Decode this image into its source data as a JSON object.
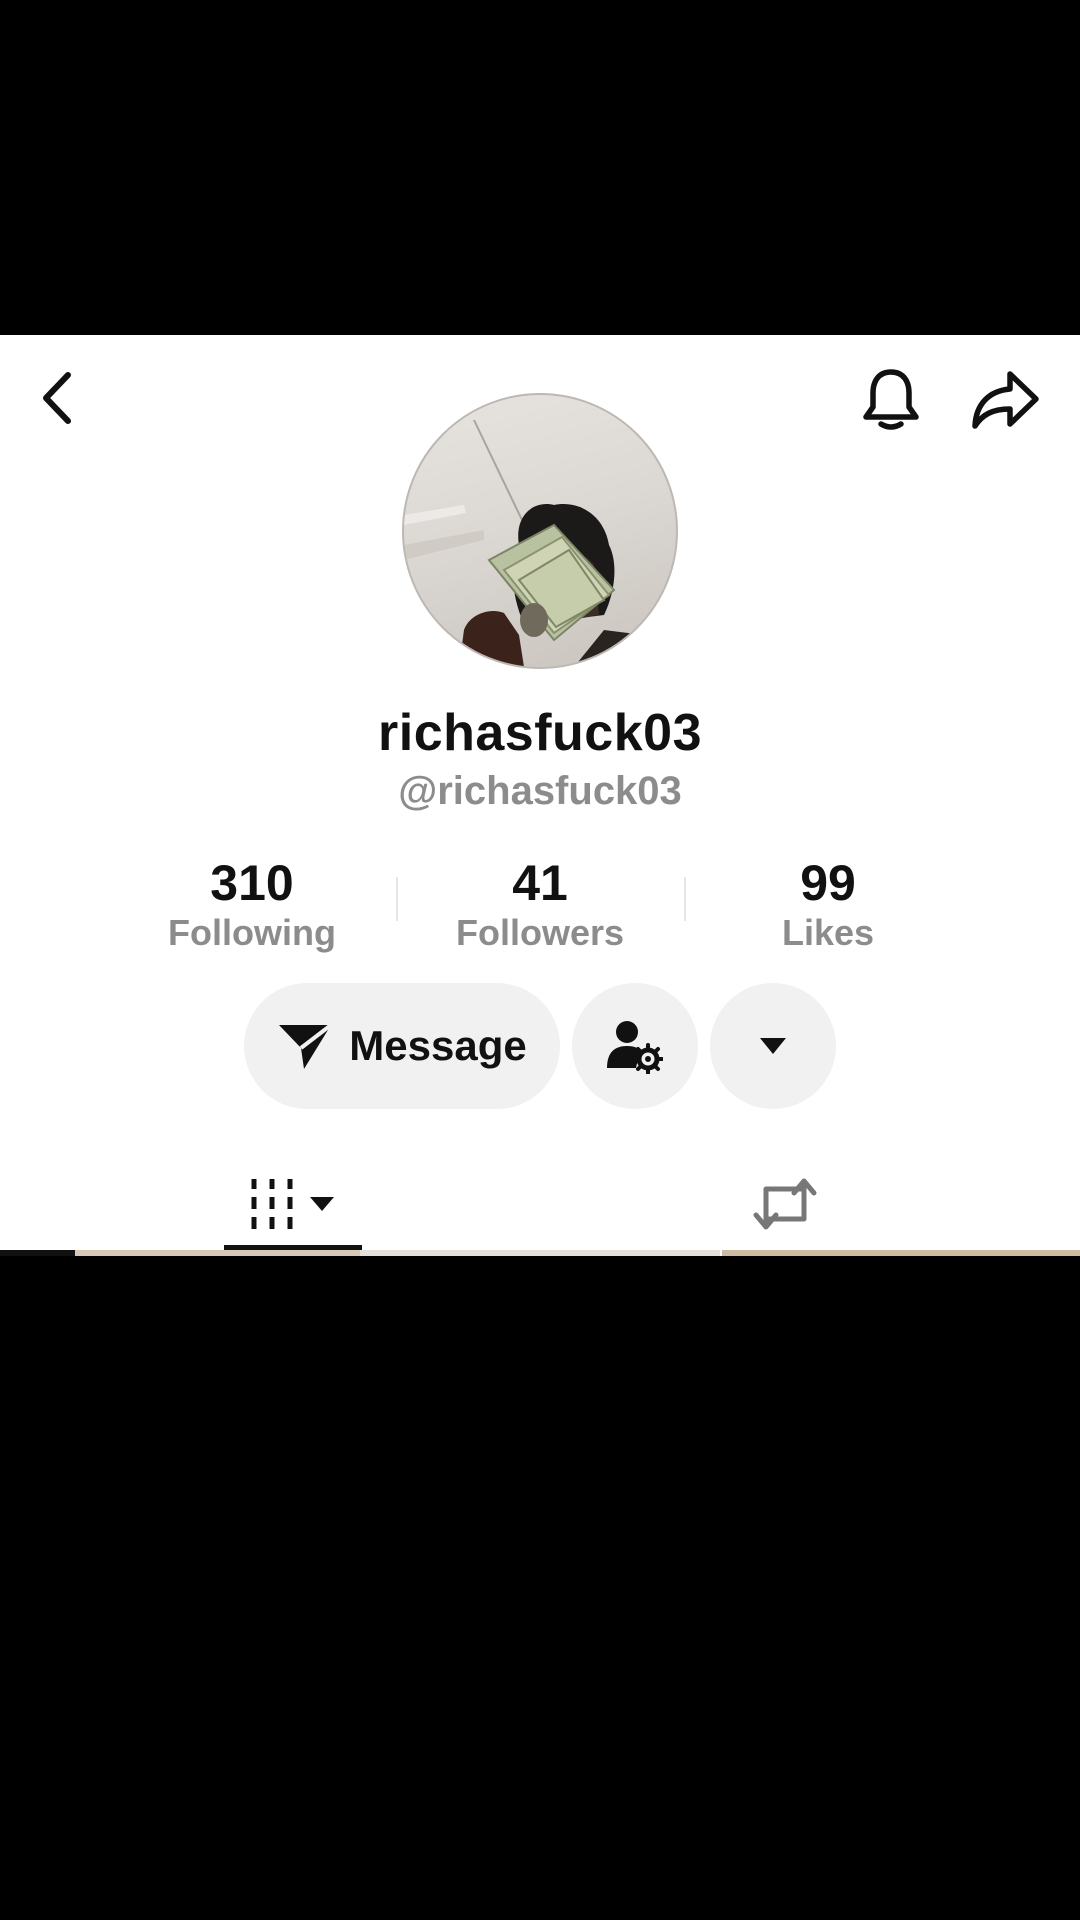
{
  "profile": {
    "display_name": "richasfuck03",
    "handle": "@richasfuck03"
  },
  "stats": [
    {
      "value": "310",
      "label": "Following"
    },
    {
      "value": "41",
      "label": "Followers"
    },
    {
      "value": "99",
      "label": "Likes"
    }
  ],
  "actions": {
    "message_label": "Message"
  },
  "icons": {
    "back": "chevron-left-icon",
    "notifications": "bell-icon",
    "share": "share-arrow-icon",
    "message": "send-icon",
    "friend_settings": "user-gear-icon",
    "more": "caret-down-icon",
    "videos_tab": "grid-bars-icon",
    "reposts_tab": "repost-icon"
  },
  "colors": {
    "primary_text": "#111111",
    "secondary_text": "#8c8c8c",
    "button_bg": "#f1f1f1",
    "letterbox": "#000000"
  }
}
